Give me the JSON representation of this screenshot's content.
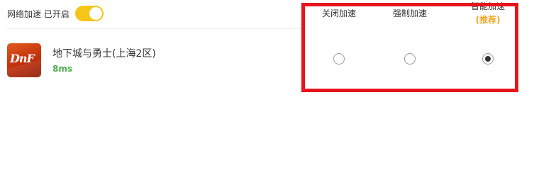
{
  "acceleration": {
    "label": "网络加速 已开启",
    "enabled": true
  },
  "game": {
    "name": "地下城与勇士(上海2区)",
    "latency": "8ms",
    "icon": "dnf-game-logo",
    "icon_text": "DnF"
  },
  "modes": [
    {
      "label": "关闭加速",
      "sub": "",
      "selected": false
    },
    {
      "label": "强制加速",
      "sub": "",
      "selected": false
    },
    {
      "label": "智能加速",
      "sub": "(推荐)",
      "selected": true
    }
  ],
  "colors": {
    "toggle_on": "#f5c518",
    "latency": "#4caf50",
    "recommend": "#f5a623",
    "highlight_border": "#e8141c"
  }
}
